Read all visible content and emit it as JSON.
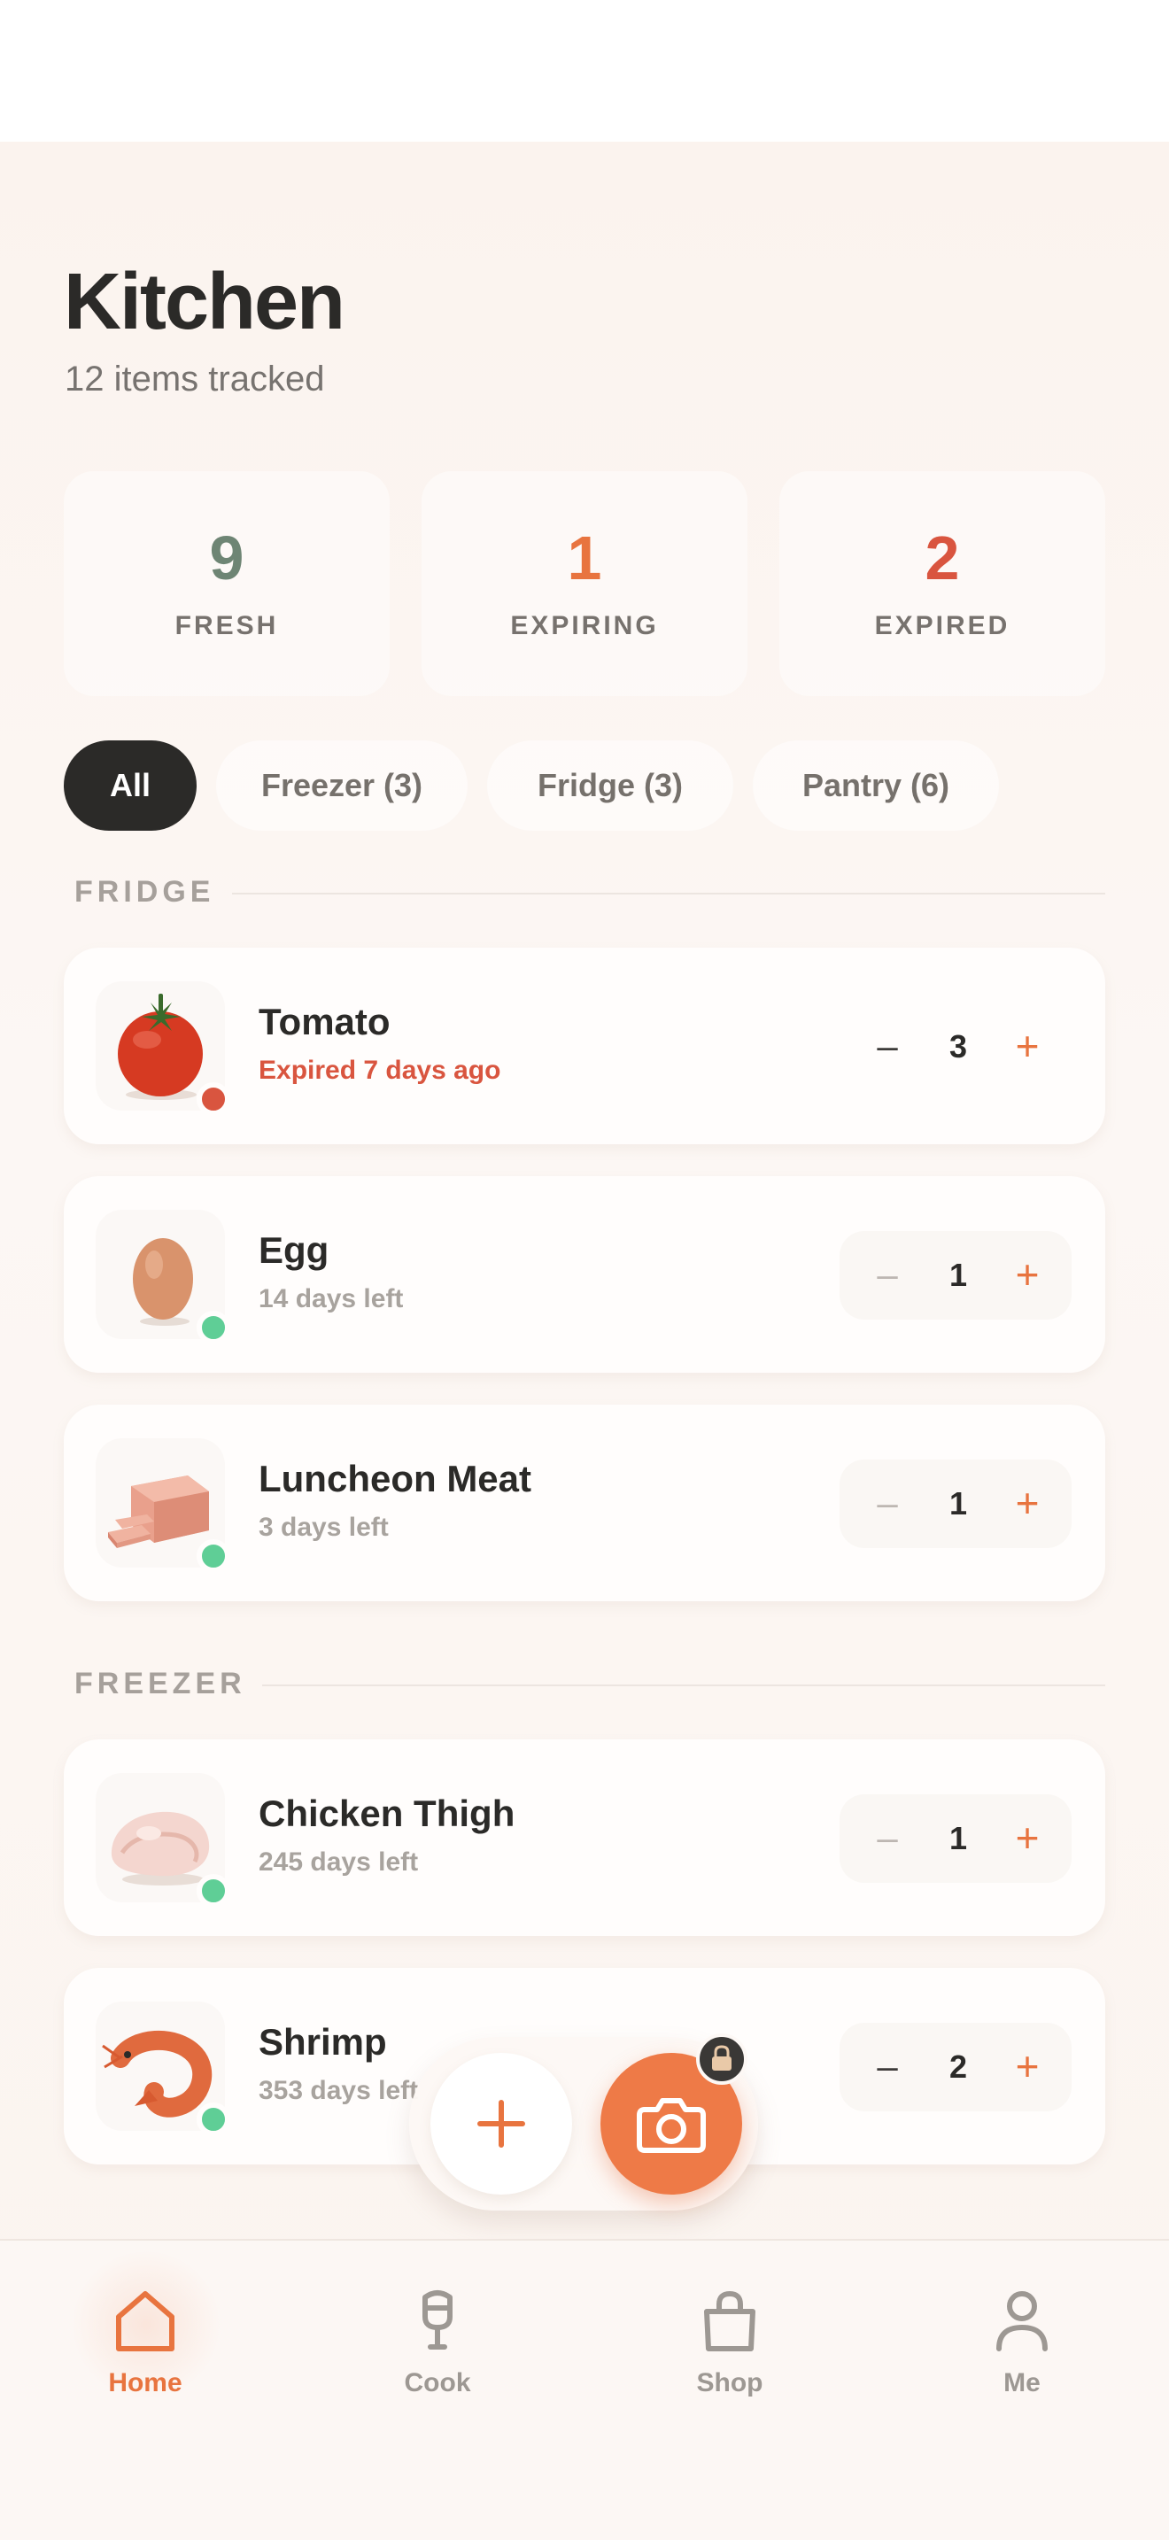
{
  "header": {
    "title": "Kitchen",
    "subtitle": "12 items tracked"
  },
  "stats": [
    {
      "value": "9",
      "label": "FRESH",
      "color": "#6e8574"
    },
    {
      "value": "1",
      "label": "EXPIRING",
      "color": "#e8743f"
    },
    {
      "value": "2",
      "label": "EXPIRED",
      "color": "#d9553f"
    }
  ],
  "filters": [
    {
      "label": "All",
      "active": true
    },
    {
      "label": "Freezer (3)",
      "active": false
    },
    {
      "label": "Fridge (3)",
      "active": false
    },
    {
      "label": "Pantry (6)",
      "active": false
    }
  ],
  "sections": {
    "fridge": {
      "title": "FRIDGE",
      "items": [
        {
          "name": "Tomato",
          "status": "Expired 7 days ago",
          "state": "expired",
          "quantity": "3",
          "icon": "tomato-icon"
        },
        {
          "name": "Egg",
          "status": "14 days left",
          "state": "fresh",
          "quantity": "1",
          "icon": "egg-icon"
        },
        {
          "name": "Luncheon Meat",
          "status": "3 days left",
          "state": "fresh",
          "quantity": "1",
          "icon": "luncheon-meat-icon"
        }
      ]
    },
    "freezer": {
      "title": "FREEZER",
      "items": [
        {
          "name": "Chicken Thigh",
          "status": "245 days left",
          "state": "fresh",
          "quantity": "1",
          "icon": "chicken-thigh-icon"
        },
        {
          "name": "Shrimp",
          "status": "353 days left",
          "state": "fresh",
          "quantity": "2",
          "icon": "shrimp-icon"
        }
      ]
    }
  },
  "stepper": {
    "minus": "–",
    "plus": "+"
  },
  "fab": {
    "add_icon": "plus-icon",
    "camera_icon": "camera-icon",
    "lock_icon": "lock-icon"
  },
  "nav": [
    {
      "label": "Home",
      "icon": "home-icon",
      "active": true
    },
    {
      "label": "Cook",
      "icon": "cook-icon",
      "active": false
    },
    {
      "label": "Shop",
      "icon": "shop-bag-icon",
      "active": false
    },
    {
      "label": "Me",
      "icon": "person-icon",
      "active": false
    }
  ],
  "colors": {
    "accent": "#e8743f",
    "fresh_dot": "#5fce96",
    "expired_dot": "#d9553f",
    "chip_active": "#2b2a28"
  }
}
